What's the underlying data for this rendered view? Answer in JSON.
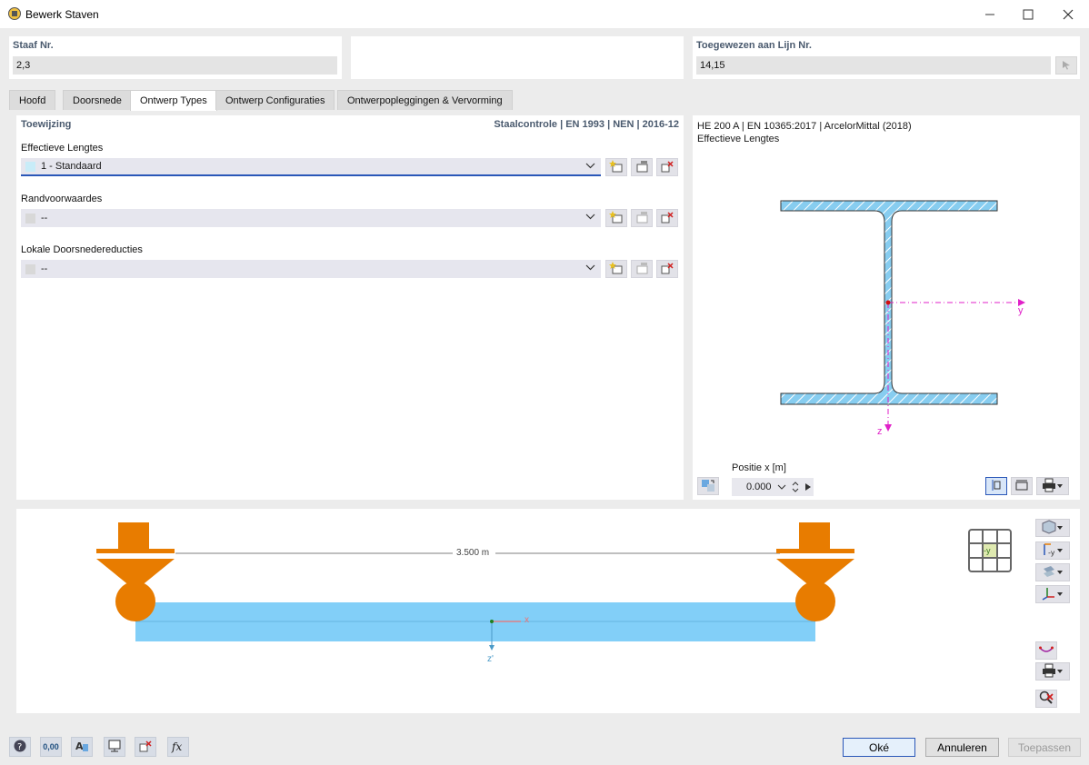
{
  "window": {
    "title": "Bewerk Staven",
    "icons": {
      "app": "member-icon",
      "minimize": "minimize-icon",
      "maximize": "maximize-icon",
      "close": "close-icon"
    }
  },
  "header": {
    "member_label": "Staaf Nr.",
    "member_value": "2,3",
    "line_label": "Toegewezen aan Lijn Nr.",
    "line_value": "14,15"
  },
  "tabs": [
    {
      "label": "Hoofd",
      "active": false
    },
    {
      "label": "Doorsnede",
      "active": false
    },
    {
      "label": "Ontwerp Types",
      "active": true
    },
    {
      "label": "Ontwerp Configuraties",
      "active": false
    },
    {
      "label": "Ontwerpopleggingen & Vervorming",
      "active": false
    }
  ],
  "assignment": {
    "title": "Toewijzing",
    "standard": "Staalcontrole | EN 1993 | NEN | 2016-12",
    "effective_lengths": {
      "label": "Effectieve Lengtes",
      "value": "1 - Standaard",
      "swatch": "#c8ecf8"
    },
    "boundary": {
      "label": "Randvoorwaardes",
      "value": "--",
      "swatch": "#d8d8d8"
    },
    "reductions": {
      "label": "Lokale Doorsnedereducties",
      "value": "--",
      "swatch": "#d8d8d8"
    }
  },
  "section_view": {
    "line1": "HE 200 A | EN 10365:2017 | ArcelorMittal (2018)",
    "line2": "Effectieve Lengtes",
    "axis_y": "y",
    "axis_z": "z",
    "position_label": "Positie x [m]",
    "position_value": "0.000"
  },
  "beam_view": {
    "length_label": "3.500 m",
    "axis_x": "x",
    "axis_z": "z'",
    "view_label": "-y"
  },
  "buttons": {
    "ok": "Oké",
    "cancel": "Annuleren",
    "apply": "Toepassen",
    "units_icon_text": "0,00"
  },
  "colors": {
    "accent": "#2a57b8",
    "section_fill": "#87cdf0",
    "support_orange": "#e87c00",
    "axis_magenta": "#e020c8",
    "beam_fill": "#82cff8"
  }
}
